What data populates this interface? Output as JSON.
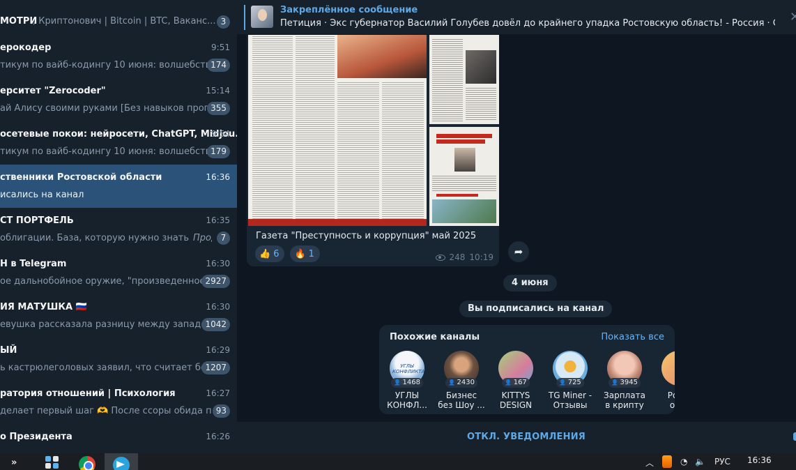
{
  "sidebar": {
    "chats": [
      {
        "name": "МОТРИ",
        "name_tail": ", Криптонович | Bitcoin | BTC, Ваканс...",
        "time": "",
        "preview": "",
        "preview_tag": "",
        "badge": "3",
        "active": false
      },
      {
        "name": "ерокодер",
        "time": "9:51",
        "preview": "тикум по вайб-кодингу 10 июня: волшебство ...",
        "preview_tag": "",
        "badge": "174",
        "active": false
      },
      {
        "name": "ерситет \"Zerocoder\"",
        "time": "15:14",
        "preview": "ай Алису своими руками [Без навыков програ...",
        "preview_tag": "",
        "badge": "355",
        "active": false
      },
      {
        "name": "осетевые покои: нейросети, ChatGPT, Midjou...",
        "time": "9:54",
        "preview": "тикум по вайб-кодингу 10 июня: волшебство ...",
        "preview_tag": "",
        "badge": "179",
        "active": false
      },
      {
        "name": "ственники Ростовской области",
        "time": "16:36",
        "preview": "исались на канал",
        "preview_tag": "",
        "badge": "",
        "active": true
      },
      {
        "name": "СТ ПОРТФЕЛЬ",
        "time": "16:35",
        "preview": "облигации. База, которую нужно знать",
        "preview_tag": "Продол...",
        "badge": "7",
        "active": false
      },
      {
        "name": "Н в Telegram",
        "time": "16:30",
        "preview": "ое дальнобойное оружие, \"произведенное н...",
        "preview_tag": "",
        "badge": "2927",
        "active": false
      },
      {
        "name": "ИЯ МАТУШКА 🇷🇺",
        "time": "16:30",
        "preview": "евушка рассказала разницу между западом ...",
        "preview_tag": "",
        "badge": "1042",
        "active": false
      },
      {
        "name": "ЫЙ",
        "time": "16:29",
        "preview": "ь кастрюлеголовых заявил, что считает бесс...",
        "preview_tag": "",
        "badge": "1207",
        "active": false
      },
      {
        "name": "ратория отношений | Психология",
        "time": "16:27",
        "preview": "делает первый шаг 🫶 После ссоры обида пос...",
        "preview_tag": "",
        "badge": "93",
        "active": false
      },
      {
        "name": "о Президента",
        "time": "16:26",
        "preview": "",
        "preview_tag": "",
        "badge": "",
        "active": false
      }
    ]
  },
  "pinned": {
    "title": "Закреплённое сообщение",
    "text": "Петиция · Экс губернатор Василий Голубев довёл до крайнего упадка Ростовскую область! - Россия · Change.org ...",
    "close": "✕"
  },
  "post": {
    "scan_red_line": "Редакция ежемесячного профессионального и доброкачественного издания. Тел.: 8-938-149-30-88",
    "scan_headline_top": "ВЗЯТЬ В ДОЛГ И ПОТЕРЯТЬ ЖИЛЬЁ",
    "scan_headline_bottom": "НОВЫЙ РУКОВОДИТЕЛЬ ПОЛИЦЕЙСКОГО ГЛАВКА ДОНА",
    "scan_headline_bottom2": "СНЕСЛИ ПАМЯТНИК",
    "caption": "Газета \"Преступность и коррупция\" май 2025",
    "reactions": [
      {
        "emoji": "👍",
        "count": "6"
      },
      {
        "emoji": "🔥",
        "count": "1"
      }
    ],
    "views": "248",
    "time": "10:19"
  },
  "service": {
    "date": "4 июня",
    "subscribed": "Вы подписались на канал"
  },
  "similar": {
    "title": "Похожие каналы",
    "show_all": "Показать все",
    "channels": [
      {
        "name": "УГЛЫ\nКОНФЛ...",
        "count": "1468",
        "avatar_text": "УГЛЫ КОНФЛИКТА"
      },
      {
        "name": "Бизнес\nбез Шоу ...",
        "count": "2430",
        "avatar_text": ""
      },
      {
        "name": "KITTYS\nDESIGN",
        "count": "167",
        "avatar_text": ""
      },
      {
        "name": "TG Miner -\nОтзывы",
        "count": "725",
        "avatar_text": ""
      },
      {
        "name": "Зарплата\nв крипту",
        "count": "3945",
        "avatar_text": ""
      },
      {
        "name": "Роз...\nоб...",
        "count": "",
        "avatar_text": ""
      }
    ]
  },
  "mute_button": "ОТКЛ. УВЕДОМЛЕНИЯ",
  "taskbar": {
    "chevron": "»",
    "language": "РУС",
    "clock": "16:36"
  },
  "colors": {
    "sidebar_bg": "#17212b",
    "chat_bg": "#0e1621",
    "active_chat": "#2b5278",
    "accent": "#5fa8e6",
    "badge": "#3e546a"
  }
}
